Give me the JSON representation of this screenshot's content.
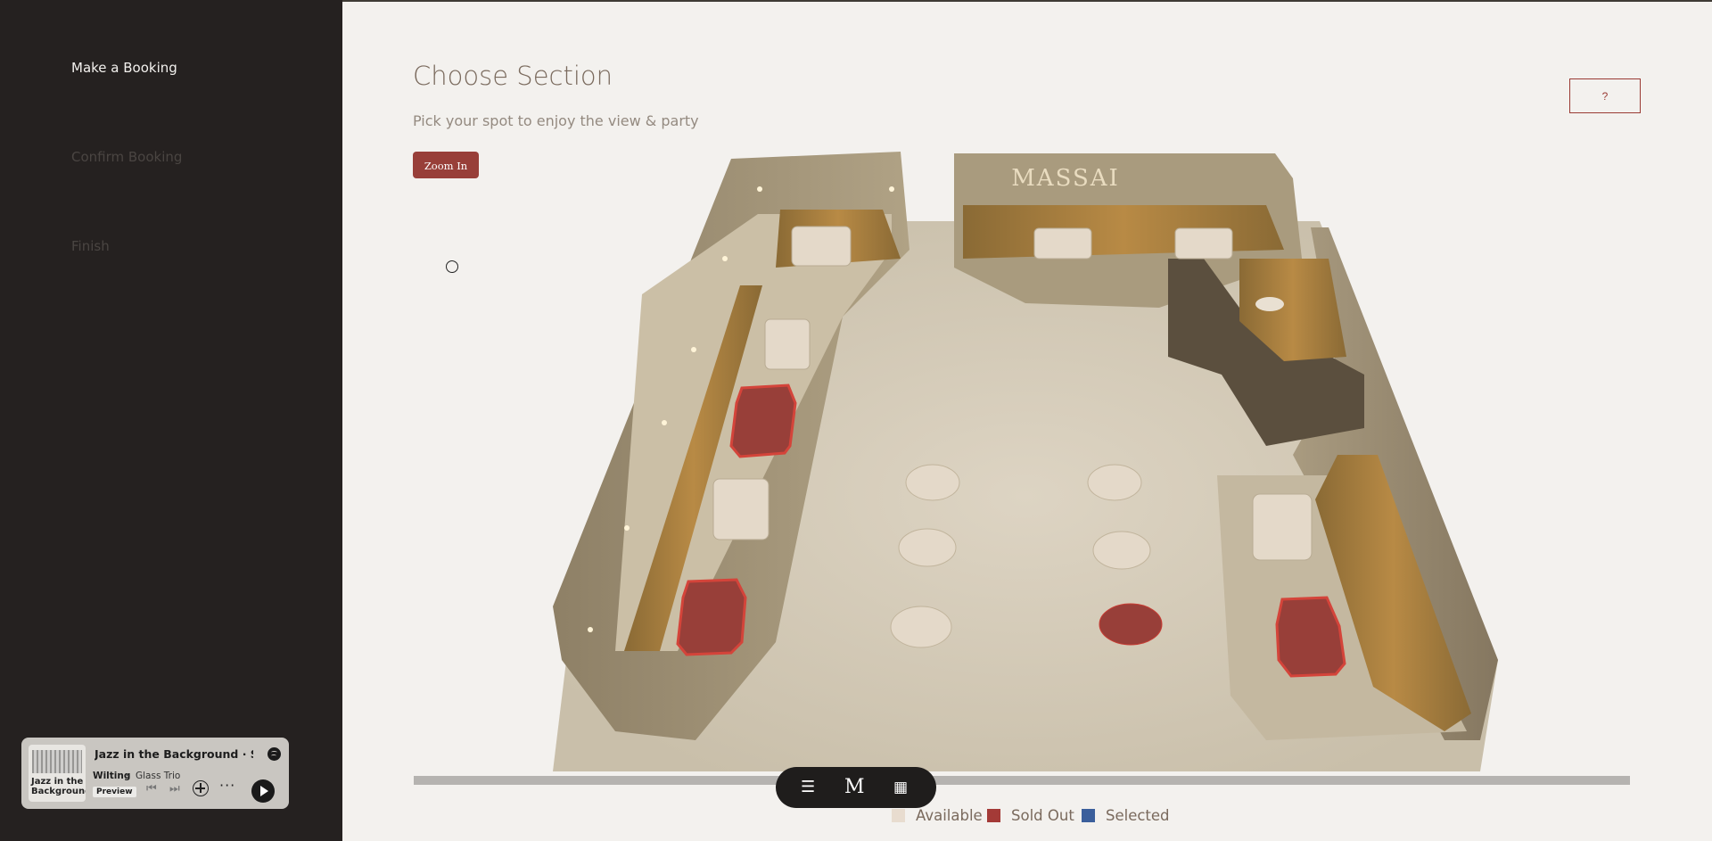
{
  "sidebar": {
    "steps": [
      {
        "label": "Make a Booking",
        "state": "active"
      },
      {
        "label": "Confirm Booking",
        "state": "inactive"
      },
      {
        "label": "Finish",
        "state": "inactive"
      }
    ]
  },
  "player": {
    "title": "Jazz in the Background · Spotify",
    "cover_text": "Jazz in the Background",
    "track": "Wilting",
    "separator": "·",
    "artist": "Glass Trio",
    "badge": "Preview",
    "icons": [
      "spotify-icon",
      "previous-icon",
      "next-icon",
      "add-icon",
      "more-icon",
      "play-icon"
    ]
  },
  "main": {
    "title": "Choose Section",
    "subtitle": "Pick your spot to enjoy the view & party",
    "zoom_label": "Zoom In",
    "help_label": "?"
  },
  "venue": {
    "sign": "MASSAI",
    "sections": [
      {
        "id": "booth-top-left",
        "status": "available"
      },
      {
        "id": "booth-top-center",
        "status": "available"
      },
      {
        "id": "booth-top-right",
        "status": "available"
      },
      {
        "id": "left-1",
        "status": "available"
      },
      {
        "id": "left-2",
        "status": "sold_out"
      },
      {
        "id": "left-3",
        "status": "available"
      },
      {
        "id": "left-4",
        "status": "sold_out"
      },
      {
        "id": "center-left-1",
        "status": "available"
      },
      {
        "id": "center-left-2",
        "status": "available"
      },
      {
        "id": "center-left-3",
        "status": "available"
      },
      {
        "id": "center-right-1",
        "status": "available"
      },
      {
        "id": "center-right-2",
        "status": "available"
      },
      {
        "id": "center-right-3",
        "status": "sold_out"
      },
      {
        "id": "right-1",
        "status": "available"
      },
      {
        "id": "right-2",
        "status": "sold_out"
      }
    ]
  },
  "toolbar": {
    "items": [
      "menu-icon",
      "logo-icon",
      "calendar-icon"
    ],
    "logo_text": "M"
  },
  "legend": {
    "items": [
      {
        "label": "Available",
        "color": "#e8dccf"
      },
      {
        "label": "Sold Out",
        "color": "#a43a37"
      },
      {
        "label": "Selected",
        "color": "#3b5f9c"
      }
    ]
  },
  "colors": {
    "sidebar_bg": "#252120",
    "accent": "#983f39",
    "page_bg": "#f3f1ee"
  }
}
